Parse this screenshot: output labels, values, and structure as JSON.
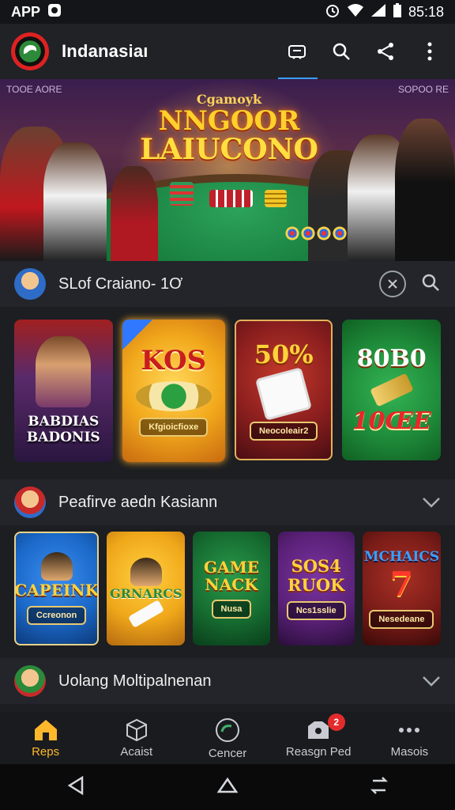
{
  "status_bar": {
    "left_label": "APP",
    "time": "85:18"
  },
  "app_bar": {
    "title": "Indanasiaı"
  },
  "hero": {
    "line1": "Cgamoyk",
    "line2": "NNGOOR",
    "line3": "LAIUCONO",
    "sign_left": "TOOE AORE",
    "sign_right": "SOPOO RE"
  },
  "section1": {
    "title": "SLof Craiano- 1Ơ",
    "cards": [
      {
        "title": "BABDIAS BADONIS",
        "sub": "",
        "bg": "#5a2a6a"
      },
      {
        "title": "KOS",
        "sub": "Kfgioicfioxe",
        "bg": "#f2a91c"
      },
      {
        "title": "50%",
        "sub": "Neocoleair2",
        "bg": "#8a1e1e"
      },
      {
        "title": "80B0",
        "sub": "10ŒE",
        "bg": "#1f8d3b"
      }
    ]
  },
  "section2": {
    "title": "Peafirve aedn Kasiann",
    "cards": [
      {
        "title": "CAPEINK",
        "sub": "Ccreonon",
        "bg": "#1b69c9"
      },
      {
        "title": "GRNARCS",
        "sub": "",
        "bg": "#f0a81a"
      },
      {
        "title": "GAME NACK",
        "sub": "Nusa",
        "bg": "#166d31"
      },
      {
        "title": "SOS4 RUOK",
        "sub": "Ncs1sslie",
        "bg": "#5a2178"
      },
      {
        "title": "MCHAICS",
        "sub": "Nesedeane",
        "bg": "#7a1c18"
      }
    ]
  },
  "section3": {
    "title": "Uolang Moltipalnenan"
  },
  "bottom_nav": [
    {
      "label": "Reps",
      "icon": "home-icon",
      "active": true
    },
    {
      "label": "Acaist",
      "icon": "cube-icon",
      "active": false
    },
    {
      "label": "Cencer",
      "icon": "circle-refresh-icon",
      "active": false
    },
    {
      "label": "Reasgn Ped",
      "icon": "shield-icon",
      "active": false,
      "badge": "2"
    },
    {
      "label": "Masois",
      "icon": "more-icon",
      "active": false
    }
  ],
  "colors": {
    "accent": "#ffb82b",
    "tab_indicator": "#3aa0ff",
    "badge": "#e42b2b"
  }
}
